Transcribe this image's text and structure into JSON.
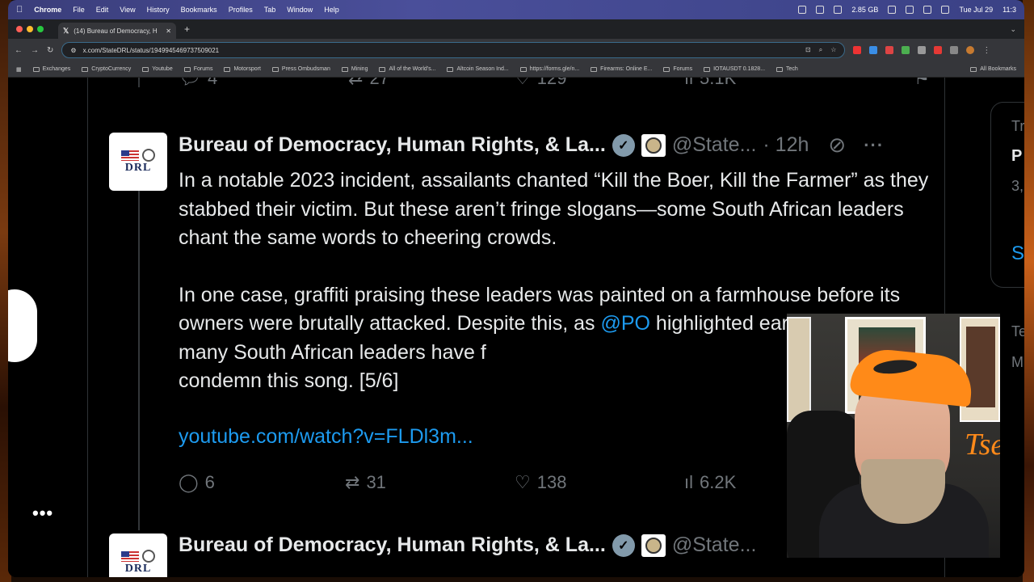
{
  "menubar": {
    "items": [
      "Chrome",
      "File",
      "Edit",
      "View",
      "History",
      "Bookmarks",
      "Profiles",
      "Tab",
      "Window",
      "Help"
    ],
    "right": [
      "2.85 GB",
      "Tue Jul 29",
      "11:3"
    ]
  },
  "browser": {
    "tab_title": "(14) Bureau of Democracy, H",
    "new_tab": "+",
    "url": "x.com/StateDRL/status/1949945469737509021"
  },
  "bookmarks": [
    "Exchanges",
    "CryptoCurrency",
    "Youtube",
    "Forums",
    "Motorsport",
    "Press Ombudsman",
    "Mining",
    "All of the World's...",
    "Altcoin Season Ind...",
    "https://forms.gle/n...",
    "Firearms: Online E...",
    "Forums",
    "IOTAUSDT 0.1828...",
    "Tech",
    "All Bookmarks"
  ],
  "prev_tweet": {
    "replies": "4",
    "reposts": "27",
    "likes": "129",
    "views": "5.1K"
  },
  "tweet1": {
    "author": "Bureau of Democracy, Human Rights, & La...",
    "handle": "@State...",
    "time": "· 12h",
    "avatar_text": "DRL",
    "para1": "In a notable 2023 incident, assailants chanted “Kill the Boer, Kill the Farmer” as they stabbed their victim. But these aren’t fringe slogans—some South African leaders chant the same words to cheering crowds.",
    "para2_a": "In one case, graffiti praising these leaders was painted on a farmhouse before its owners were brutally attacked. Despite this, as ",
    "mention": "@PO",
    "para2_b": " highlighted earlier this year, many South African leaders have f",
    "para2_c": "condemn this song. [5/6]",
    "link": "youtube.com/watch?v=FLDl3m...",
    "replies": "6",
    "reposts": "31",
    "likes": "138",
    "views": "6.2K"
  },
  "tweet2": {
    "author": "Bureau of Democracy, Human Rights, & La...",
    "handle": "@State...",
    "avatar_text": "DRL"
  },
  "right_column": {
    "t1": "Tr",
    "b1": "P",
    "n1": "3,",
    "blue": "S",
    "t2": "Te",
    "t3": "M"
  },
  "more": "•••",
  "colors": {
    "accent": "#1d9bf0",
    "muted": "#71767b",
    "text": "#e7e9ea"
  }
}
